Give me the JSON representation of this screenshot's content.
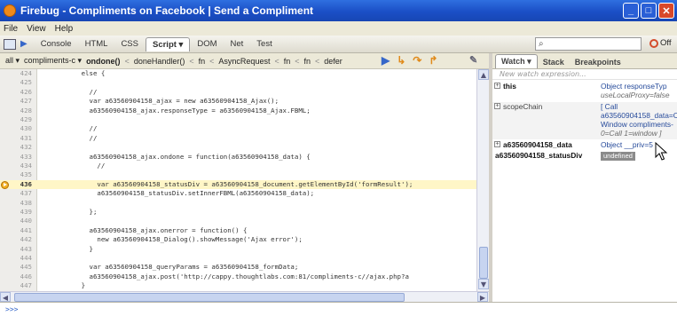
{
  "window": {
    "title": "Firebug - Compliments on Facebook | Send a Compliment"
  },
  "menu": {
    "items": [
      "File",
      "View",
      "Help"
    ]
  },
  "toolbar": {
    "tabs": [
      "Console",
      "HTML",
      "CSS",
      "Script ▾",
      "DOM",
      "Net",
      "Test"
    ],
    "active_tab_index": 3,
    "off_label": "Off"
  },
  "pathbar": {
    "items": [
      "all ▾",
      "compliments-c ▾",
      "ondone()",
      "<",
      "doneHandler()",
      "<",
      "fn",
      "<",
      "AsyncRequest",
      "<",
      "fn",
      "<",
      "fn",
      "<",
      "defer"
    ]
  },
  "code": {
    "lines": [
      {
        "n": "424",
        "t": "        else {"
      },
      {
        "n": "425",
        "t": ""
      },
      {
        "n": "426",
        "t": "          //"
      },
      {
        "n": "427",
        "t": "          var a63560904158_ajax = new a63560904158_Ajax();"
      },
      {
        "n": "428",
        "t": "          a63560904158_ajax.responseType = a63560904158_Ajax.FBML;"
      },
      {
        "n": "429",
        "t": ""
      },
      {
        "n": "430",
        "t": "          //"
      },
      {
        "n": "431",
        "t": "          //"
      },
      {
        "n": "432",
        "t": ""
      },
      {
        "n": "433",
        "t": "          a63560904158_ajax.ondone = function(a63560904158_data) {"
      },
      {
        "n": "434",
        "t": "            //"
      },
      {
        "n": "435",
        "t": ""
      },
      {
        "n": "436",
        "t": "            var a63560904158_statusDiv = a63560904158_document.getElementById('formResult');",
        "exec": true
      },
      {
        "n": "437",
        "t": "            a63560904158_statusDiv.setInnerFBML(a63560904158_data);"
      },
      {
        "n": "438",
        "t": ""
      },
      {
        "n": "439",
        "t": "          };"
      },
      {
        "n": "440",
        "t": ""
      },
      {
        "n": "441",
        "t": "          a63560904158_ajax.onerror = function() {"
      },
      {
        "n": "442",
        "t": "            new a63560904158_Dialog().showMessage('Ajax error');"
      },
      {
        "n": "443",
        "t": "          }"
      },
      {
        "n": "444",
        "t": ""
      },
      {
        "n": "445",
        "t": "          var a63560904158_queryParams = a63560904158_formData;"
      },
      {
        "n": "446",
        "t": "          a63560904158_ajax.post('http://cappy.thoughtlabs.com:81/compliments-c//ajax.php?a"
      },
      {
        "n": "447",
        "t": "        }"
      }
    ]
  },
  "side": {
    "tabs": [
      "Watch ▾",
      "Stack",
      "Breakpoints"
    ],
    "new_watch": "New watch expression...",
    "watches": [
      {
        "name": "this",
        "value_lines": [
          "Object responseTyp",
          "useLocalProxy=false"
        ],
        "bold": true
      },
      {
        "name": "scopeChain",
        "value_lines": [
          "[ Call",
          "a63560904158_data=C",
          "Window compliments-",
          "0=Call 1=window ]"
        ],
        "bold": false
      },
      {
        "name": "a63560904158_data",
        "value_lines": [
          "Object __priv=5"
        ],
        "bold": true
      },
      {
        "name": "a63560904158_statusDiv",
        "value_lines": [
          "undefined"
        ],
        "bold": true,
        "undefined": true
      }
    ]
  },
  "cmdline": {
    "prompt": ">>>"
  }
}
